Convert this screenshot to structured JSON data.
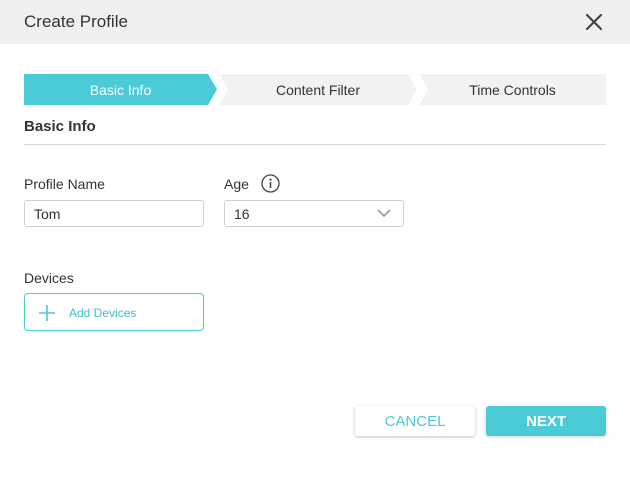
{
  "dialog": {
    "title": "Create Profile",
    "close_icon": "close-icon"
  },
  "steps": [
    {
      "label": "Basic Info",
      "active": true
    },
    {
      "label": "Content Filter",
      "active": false
    },
    {
      "label": "Time Controls",
      "active": false
    }
  ],
  "section_title": "Basic Info",
  "form": {
    "profile_name_label": "Profile Name",
    "profile_name_value": "Tom",
    "age_label": "Age",
    "age_value": "16",
    "age_info_icon": "info-icon",
    "devices_label": "Devices",
    "add_devices_label": "Add Devices"
  },
  "buttons": {
    "cancel": "CANCEL",
    "next": "NEXT"
  },
  "colors": {
    "accent": "#4acbd6",
    "step_inactive": "#f2f2f2",
    "titlebar": "#f0f0f0"
  }
}
